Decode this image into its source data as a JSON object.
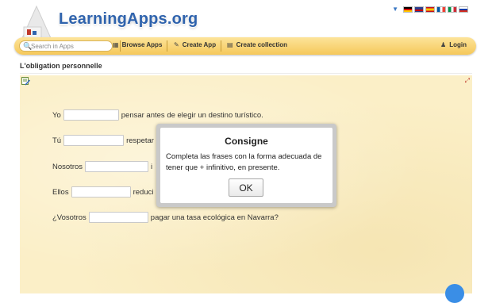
{
  "header": {
    "logo_text": "LearningApps.org",
    "languages": [
      "de",
      "en",
      "es",
      "fr",
      "it",
      "ru"
    ]
  },
  "nav": {
    "search_placeholder": "Search in Apps",
    "browse_label": "Browse Apps",
    "create_app_label": "Create App",
    "create_collection_label": "Create collection",
    "login_label": "Login"
  },
  "page": {
    "title": "L'obligation personnelle"
  },
  "exercise": {
    "lines": [
      {
        "before": "Yo",
        "after": "pensar antes de elegir un destino turístico."
      },
      {
        "before": "Tú",
        "after": "respetar"
      },
      {
        "before": "Nosotros",
        "after": "i"
      },
      {
        "before": "Ellos",
        "after": "reduci"
      },
      {
        "before": "¿Vosotros",
        "after": "pagar una tasa ecológica en Navarra?"
      }
    ]
  },
  "dialog": {
    "title": "Consigne",
    "text": "Completa las frases con la forma adecuada de tener que + infinitivo, en presente.",
    "ok_label": "OK"
  }
}
